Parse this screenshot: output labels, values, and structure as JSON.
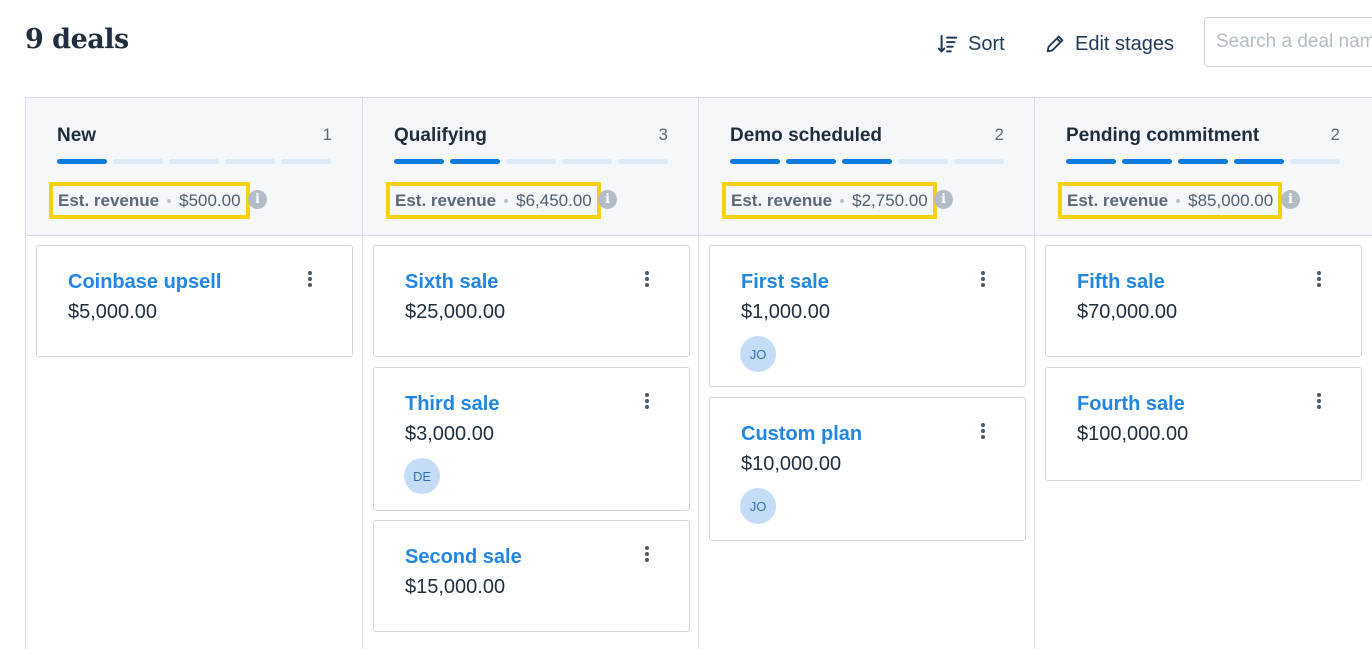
{
  "header": {
    "title": "9 deals",
    "sort_label": "Sort",
    "edit_stages_label": "Edit stages",
    "search_placeholder": "Search a deal name"
  },
  "colors": {
    "accent": "#1f86e6",
    "progress_active": "#0d7be0",
    "progress_inactive": "#dbeaf6",
    "highlight": "#f6d20c",
    "avatar_bg": "#c4dcf6"
  },
  "columns": [
    {
      "name": "New",
      "count": "1",
      "progress": [
        true,
        false,
        false,
        false,
        false
      ],
      "revenue_label": "Est. revenue",
      "revenue_value": "$500.00",
      "cards": [
        {
          "title": "Coinbase upsell",
          "amount": "$5,000.00",
          "avatar": ""
        }
      ]
    },
    {
      "name": "Qualifying",
      "count": "3",
      "progress": [
        true,
        true,
        false,
        false,
        false
      ],
      "revenue_label": "Est. revenue",
      "revenue_value": "$6,450.00",
      "cards": [
        {
          "title": "Sixth sale",
          "amount": "$25,000.00",
          "avatar": ""
        },
        {
          "title": "Third sale",
          "amount": "$3,000.00",
          "avatar": "DE"
        },
        {
          "title": "Second sale",
          "amount": "$15,000.00",
          "avatar": ""
        }
      ]
    },
    {
      "name": "Demo scheduled",
      "count": "2",
      "progress": [
        true,
        true,
        true,
        false,
        false
      ],
      "revenue_label": "Est. revenue",
      "revenue_value": "$2,750.00",
      "cards": [
        {
          "title": "First sale",
          "amount": "$1,000.00",
          "avatar": "JO"
        },
        {
          "title": "Custom plan",
          "amount": "$10,000.00",
          "avatar": "JO"
        }
      ]
    },
    {
      "name": "Pending commitment",
      "count": "2",
      "progress": [
        true,
        true,
        true,
        true,
        false
      ],
      "revenue_label": "Est. revenue",
      "revenue_value": "$85,000.00",
      "cards": [
        {
          "title": "Fifth sale",
          "amount": "$70,000.00",
          "avatar": ""
        },
        {
          "title": "Fourth sale",
          "amount": "$100,000.00",
          "avatar": ""
        }
      ]
    }
  ]
}
